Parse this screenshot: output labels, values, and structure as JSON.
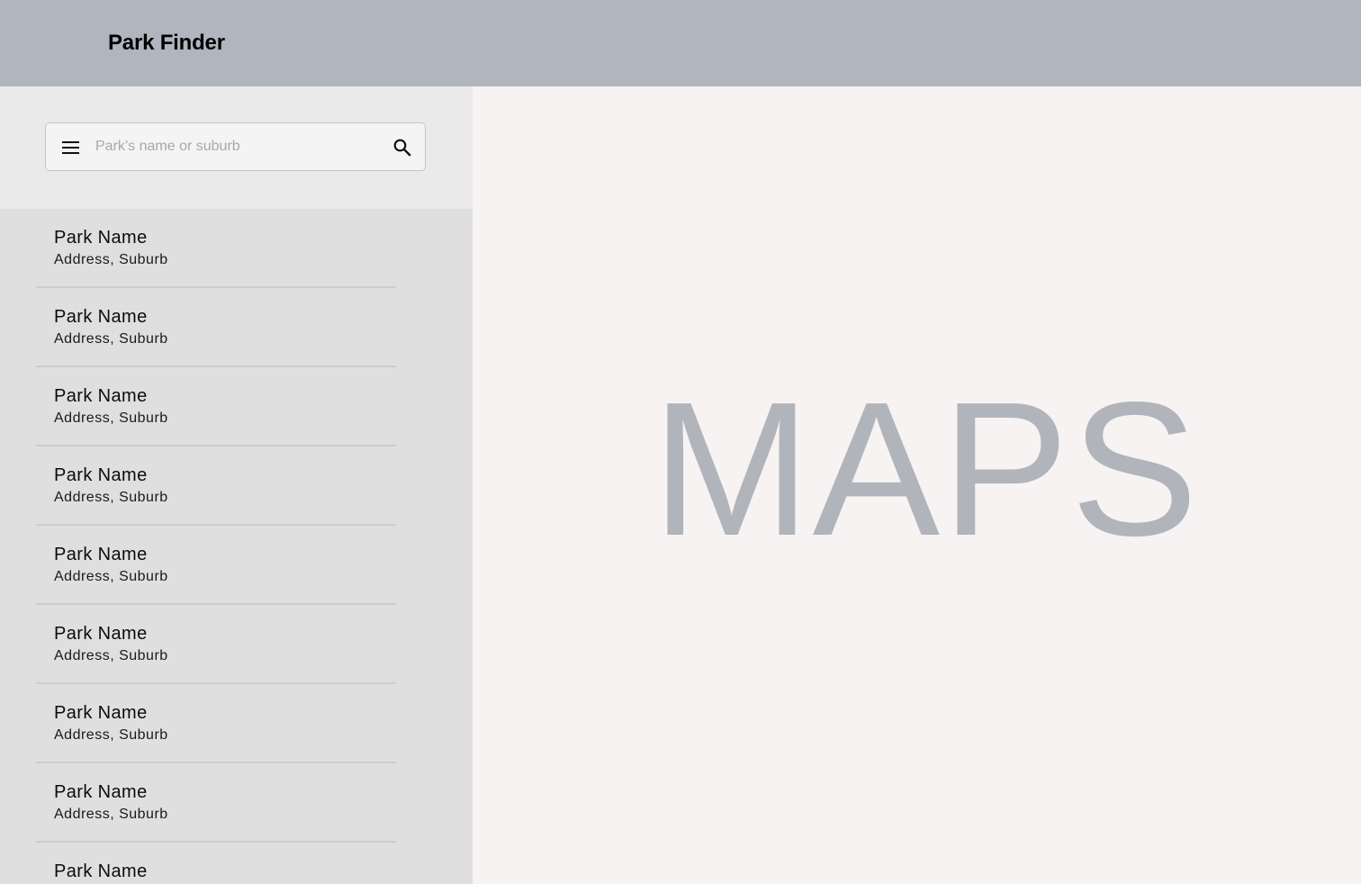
{
  "header": {
    "title": "Park Finder"
  },
  "search": {
    "placeholder": "Park’s name or suburb",
    "value": "",
    "menu_icon": "menu-icon",
    "search_icon": "search-icon"
  },
  "parks": [
    {
      "name": "Park Name",
      "address": "Address, Suburb"
    },
    {
      "name": "Park Name",
      "address": "Address, Suburb"
    },
    {
      "name": "Park Name",
      "address": "Address, Suburb"
    },
    {
      "name": "Park Name",
      "address": "Address, Suburb"
    },
    {
      "name": "Park Name",
      "address": "Address, Suburb"
    },
    {
      "name": "Park Name",
      "address": "Address, Suburb"
    },
    {
      "name": "Park Name",
      "address": "Address, Suburb"
    },
    {
      "name": "Park Name",
      "address": "Address, Suburb"
    },
    {
      "name": "Park Name",
      "address": ""
    }
  ],
  "map": {
    "placeholder_text": "MAPS"
  },
  "colors": {
    "header_bg": "#b1b5bd",
    "sidebar_bg": "#dfdfdf",
    "search_area_bg": "#eaeaea",
    "map_bg": "#f6f3f2",
    "map_text": "#b1b5bb"
  }
}
